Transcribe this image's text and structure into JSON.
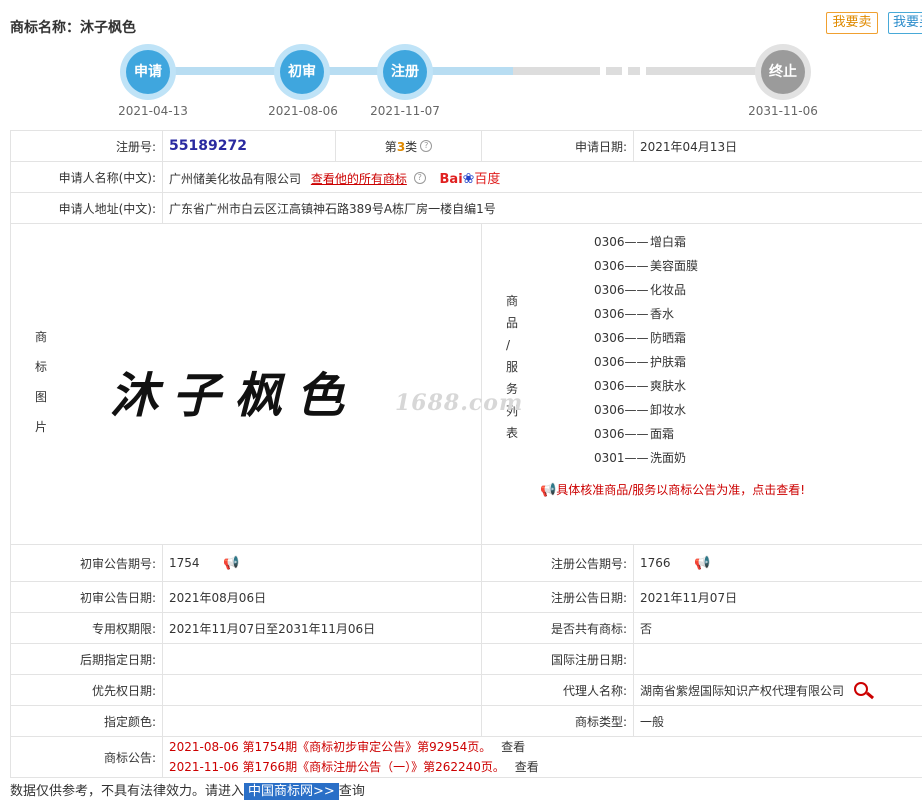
{
  "header": {
    "title_label": "商标名称：",
    "title_value": "沐子枫色",
    "sell_button": "我要卖",
    "buy_button": "我要买"
  },
  "timeline": [
    {
      "label": "申请",
      "date": "2021-04-13"
    },
    {
      "label": "初审",
      "date": "2021-08-06"
    },
    {
      "label": "注册",
      "date": "2021-11-07"
    },
    {
      "label": "终止",
      "date": "2031-11-06"
    }
  ],
  "info": {
    "reg_no_label": "注册号:",
    "reg_no": "55189272",
    "class_prefix": "第",
    "class_num": "3",
    "class_suffix": "类",
    "apply_date_label": "申请日期:",
    "apply_date": "2021年04月13日",
    "applicant_label": "申请人名称(中文):",
    "applicant": "广州储美化妆品有限公司",
    "all_marks_link": "查看他的所有商标",
    "baidu_text": "Bai",
    "baidu_cn": "百度",
    "address_label": "申请人地址(中文):",
    "address": "广东省广州市白云区江高镇神石路389号A栋厂房一楼自编1号",
    "image_label_chars": [
      "商",
      "标",
      "图",
      "片"
    ],
    "tm_image_text": "沐子枫色",
    "watermark": "1688.com",
    "goods_label_chars": [
      "商",
      "品",
      "/",
      "服",
      "务",
      "列",
      "表"
    ],
    "goods": [
      {
        "code": "0306——",
        "name": "增白霜"
      },
      {
        "code": "0306——",
        "name": "美容面膜"
      },
      {
        "code": "0306——",
        "name": "化妆品"
      },
      {
        "code": "0306——",
        "name": "香水"
      },
      {
        "code": "0306——",
        "name": "防晒霜"
      },
      {
        "code": "0306——",
        "name": "护肤霜"
      },
      {
        "code": "0306——",
        "name": "爽肤水"
      },
      {
        "code": "0306——",
        "name": "卸妆水"
      },
      {
        "code": "0306——",
        "name": "面霜"
      },
      {
        "code": "0301——",
        "name": "洗面奶"
      }
    ],
    "goods_note": "具体核准商品/服务以商标公告为准，点击查看!",
    "prelim_no_label": "初审公告期号:",
    "prelim_no": "1754",
    "reg_ann_no_label": "注册公告期号:",
    "reg_ann_no": "1766",
    "prelim_date_label": "初审公告日期:",
    "prelim_date": "2021年08月06日",
    "reg_ann_date_label": "注册公告日期:",
    "reg_ann_date": "2021年11月07日",
    "excl_label": "专用权期限:",
    "excl": "2021年11月07日至2031年11月06日",
    "shared_label": "是否共有商标:",
    "shared": "否",
    "later_label": "后期指定日期:",
    "later": "",
    "intl_label": "国际注册日期:",
    "intl": "",
    "priority_label": "优先权日期:",
    "priority": "",
    "agent_label": "代理人名称:",
    "agent": "湖南省紫煜国际知识产权代理有限公司",
    "color_label": "指定颜色:",
    "color": "",
    "type_label": "商标类型:",
    "type": "一般",
    "announce_label": "商标公告:",
    "announcements": [
      {
        "text": "2021-08-06 第1754期《商标初步审定公告》第92954页。",
        "link": "查看"
      },
      {
        "text": "2021-11-06 第1766期《商标注册公告（一）》第262240页。",
        "link": "查看"
      }
    ]
  },
  "footer": {
    "text_before": "数据仅供参考，不具有法律效力。请进入",
    "site": "中国商标网>>",
    "text_after": "查询"
  }
}
